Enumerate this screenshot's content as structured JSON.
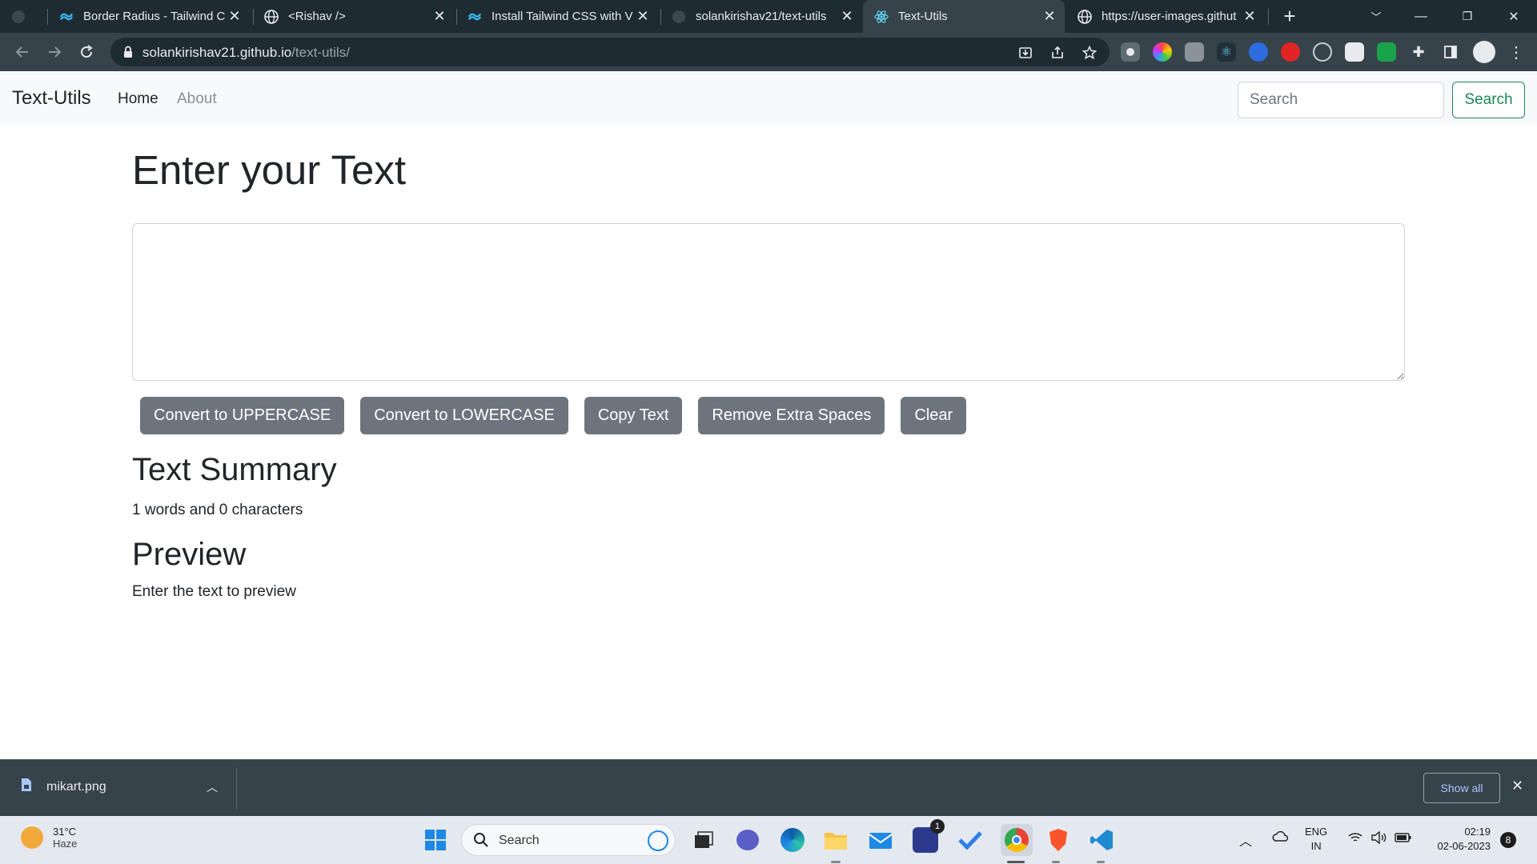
{
  "browser": {
    "tabs": [
      {
        "title": "Border Radius - Tailwind C",
        "favicon": "tailwind-icon"
      },
      {
        "title": "<Rishav />",
        "favicon": "globe-icon"
      },
      {
        "title": "Install Tailwind CSS with V",
        "favicon": "tailwind-icon"
      },
      {
        "title": "solankirishav21/text-utils",
        "favicon": "github-icon"
      },
      {
        "title": "Text-Utils",
        "favicon": "react-icon"
      },
      {
        "title": "https://user-images.githut",
        "favicon": "globe-icon"
      }
    ],
    "active_tab": 4,
    "address": {
      "domain": "solankirishav21.github.io",
      "path": "/text-utils/"
    }
  },
  "navbar": {
    "brand": "Text-Utils",
    "links": [
      {
        "label": "Home",
        "active": true
      },
      {
        "label": "About",
        "active": false
      }
    ],
    "search_placeholder": "Search",
    "search_button": "Search"
  },
  "main": {
    "heading": "Enter your Text",
    "textarea_value": "",
    "buttons": [
      "Convert to UPPERCASE",
      "Convert to LOWERCASE",
      "Copy Text",
      "Remove Extra Spaces",
      "Clear"
    ],
    "summary_heading": "Text Summary",
    "summary_text": "1 words and 0 characters",
    "preview_heading": "Preview",
    "preview_text": "Enter the text to preview"
  },
  "downloads": {
    "file_name": "mikart.png",
    "show_all": "Show all"
  },
  "taskbar": {
    "weather_temp": "31°C",
    "weather_condition": "Haze",
    "search_label": "Search",
    "mail_badge": "1",
    "language": "ENG",
    "region": "IN",
    "time": "02:19",
    "date": "02-06-2023",
    "notification_count": "8"
  },
  "colors": {
    "accent_green": "#198754",
    "button_gray": "#6c757d",
    "navbar_bg": "#f8f9fa",
    "chrome_dark": "#1f2b33",
    "chrome_toolbar": "#37434b"
  }
}
